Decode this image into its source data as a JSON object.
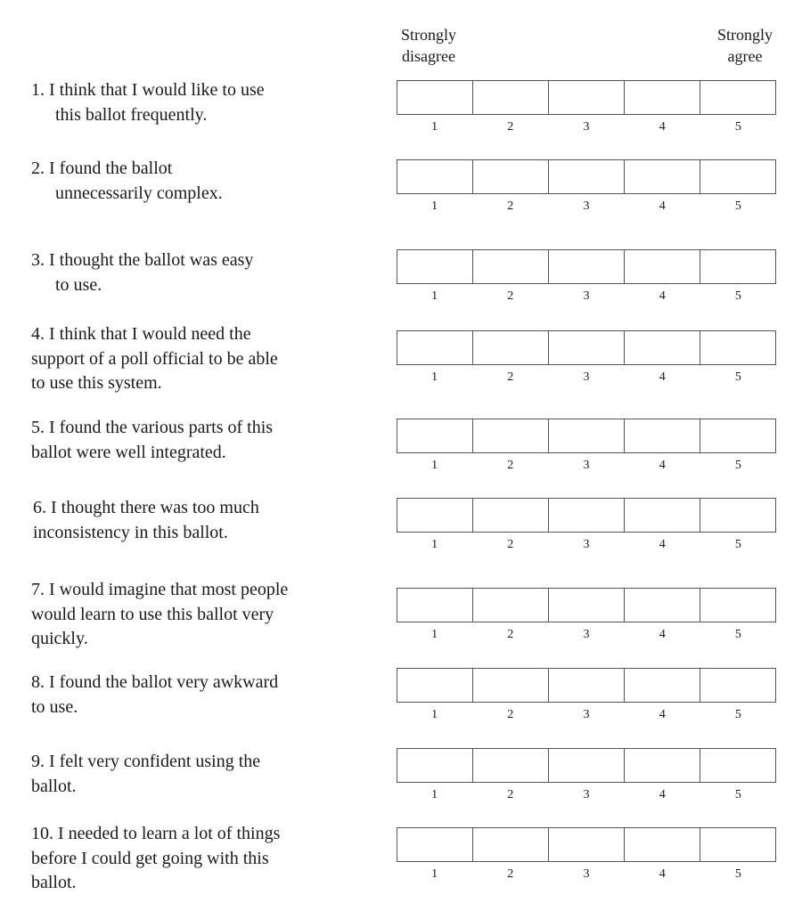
{
  "header": {
    "left_label_line1": "Strongly",
    "left_label_line2": "disagree",
    "right_label_line1": "Strongly",
    "right_label_line2": "agree"
  },
  "scale_points": [
    "1",
    "2",
    "3",
    "4",
    "5"
  ],
  "questions": [
    {
      "number": "1.",
      "lines": [
        "1.  I think that I would like to use",
        "this ballot frequently."
      ],
      "selected": null
    },
    {
      "number": "2.",
      "lines": [
        "2.  I found the ballot",
        "unnecessarily complex."
      ],
      "selected": null
    },
    {
      "number": "3.",
      "lines": [
        "3.  I thought the ballot was easy",
        "to use."
      ],
      "selected": null
    },
    {
      "number": "4.",
      "lines": [
        "4.  I think that I would need the",
        "support of a poll official to be able",
        "to use this system."
      ],
      "selected": null
    },
    {
      "number": "5.",
      "lines": [
        "5.  I found the various parts of this",
        "ballot were well integrated."
      ],
      "selected": null
    },
    {
      "number": "6.",
      "lines": [
        "6.  I thought there was too much",
        "inconsistency in this ballot."
      ],
      "selected": null
    },
    {
      "number": "7.",
      "lines": [
        "7.  I would imagine that most people",
        "would learn to use this ballot very",
        "quickly."
      ],
      "selected": null
    },
    {
      "number": "8.",
      "lines": [
        "8.  I found the ballot very awkward",
        "to use."
      ],
      "selected": null
    },
    {
      "number": "9.",
      "lines": [
        "9.  I felt very confident using the",
        "ballot."
      ],
      "selected": null
    },
    {
      "number": "10.",
      "lines": [
        "10.  I needed to learn a lot of things",
        "before I could get going with this",
        "ballot."
      ],
      "selected": null
    }
  ]
}
